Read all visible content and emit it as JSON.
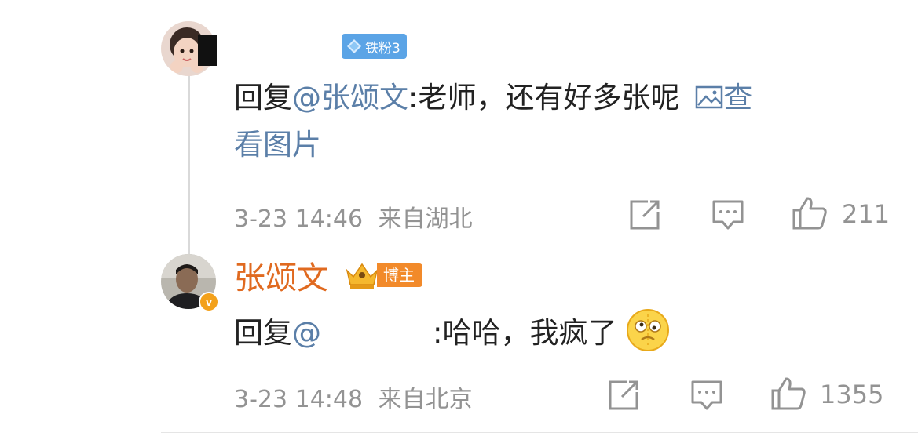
{
  "comment1": {
    "badge_label": "铁粉3",
    "text_prefix": "回复",
    "mention": "@张颂文",
    "text_body": ":老师，还有好多张呢",
    "link_label_line1": "查",
    "link_label_line2": "看图片",
    "timestamp": "3-23 14:46",
    "source": "来自湖北",
    "like_count": "211"
  },
  "comment2": {
    "author": "张颂文",
    "badge_label": "博主",
    "verify_mark": "v",
    "text_prefix": "回复",
    "mention": "@",
    "text_body": ":哈哈，我疯了",
    "timestamp": "3-23 14:48",
    "source": "来自北京",
    "like_count": "1355"
  },
  "colors": {
    "mention": "#5b7fa8",
    "author": "#e06a20",
    "meta": "#939393",
    "fan_badge": "#5ba4e6",
    "blogger_badge": "#f28a2a",
    "verify": "#f3a11b"
  },
  "icons": [
    "image-icon",
    "share-icon",
    "comment-icon",
    "like-icon",
    "diamond-icon",
    "crown-icon",
    "emoji-crazy-icon"
  ]
}
